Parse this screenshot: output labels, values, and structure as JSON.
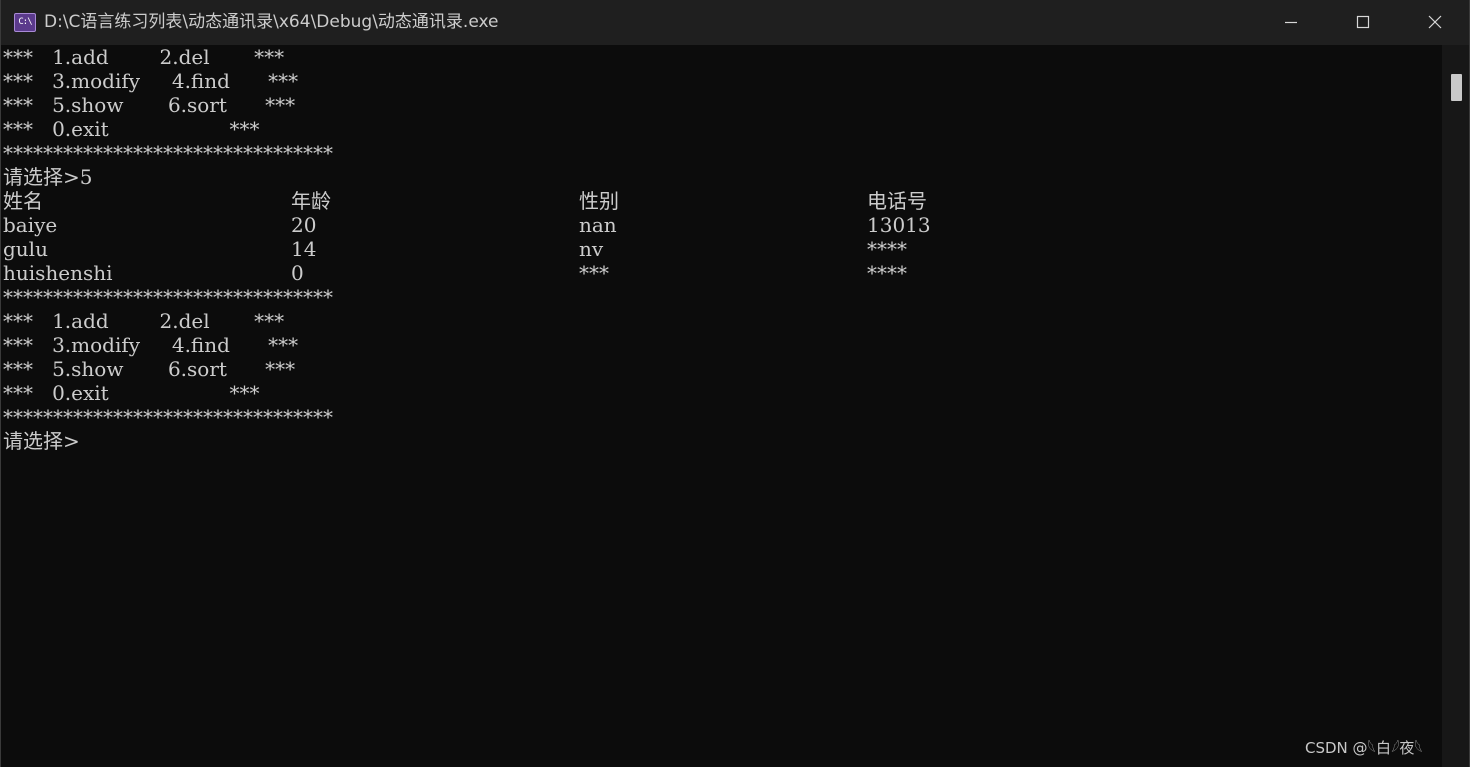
{
  "window": {
    "title": "D:\\C语言练习列表\\动态通讯录\\x64\\Debug\\动态通讯录.exe",
    "icon_label": "C:\\",
    "controls": [
      "minimize-icon",
      "maximize-icon",
      "close-icon"
    ]
  },
  "console": {
    "menu_top": [
      "***   1.add        2.del       ***",
      "***   3.modify     4.find      ***",
      "***   5.show       6.sort      ***",
      "***   0.exit                   ***",
      "*********************************"
    ],
    "prompt1": "请选择>5",
    "table": {
      "headers": [
        "姓名",
        "年龄",
        "性别",
        "电话号"
      ],
      "rows": [
        [
          "baiye",
          "20",
          "nan",
          "13013"
        ],
        [
          "gulu",
          "14",
          "nv",
          "****"
        ],
        [
          "huishenshi",
          "0",
          "***",
          "****"
        ]
      ]
    },
    "menu_bottom": [
      "*********************************",
      "***   1.add        2.del       ***",
      "***   3.modify     4.find      ***",
      "***   5.show       6.sort      ***",
      "***   0.exit                   ***",
      "*********************************"
    ],
    "prompt2": "请选择>"
  },
  "watermark": "CSDN @𓆩白𓆪夜𓆩",
  "colors": {
    "background": "#0c0c0c",
    "text": "#cccccc",
    "titlebar": "#1f1f1f"
  }
}
